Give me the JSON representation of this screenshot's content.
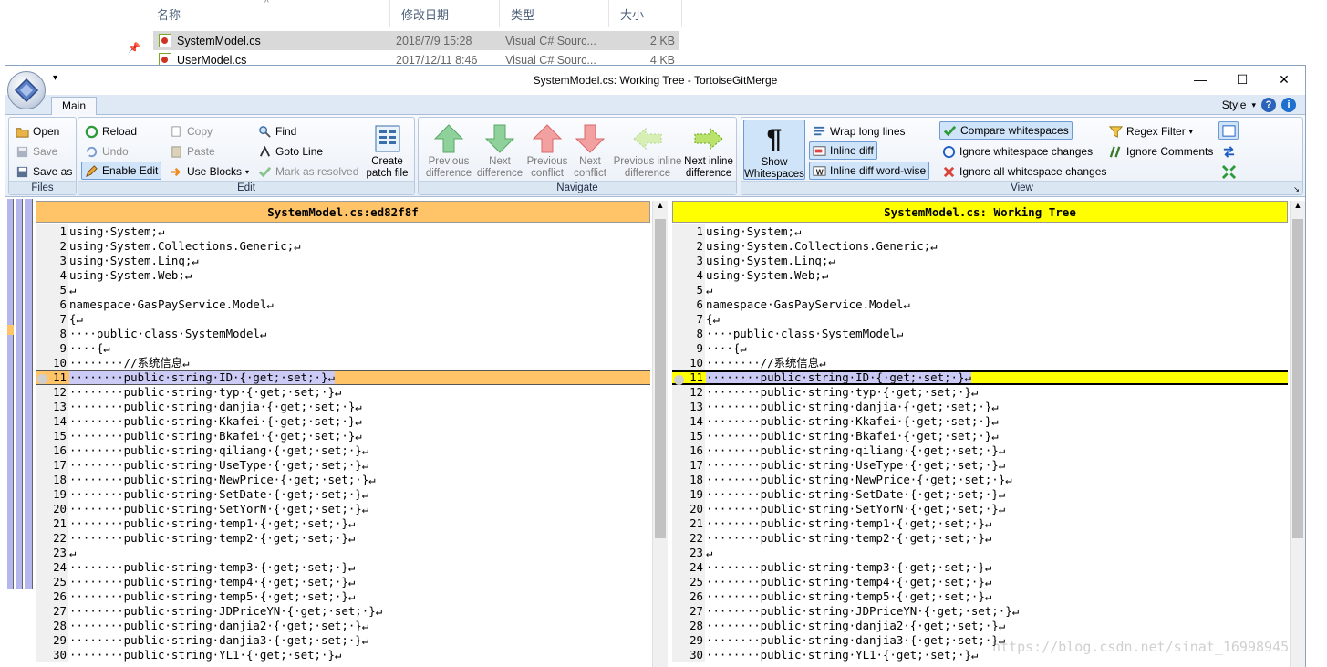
{
  "explorer": {
    "columns": [
      "名称",
      "修改日期",
      "类型",
      "大小"
    ],
    "files": [
      {
        "name": "SystemModel.cs",
        "date": "2018/7/9 15:28",
        "type": "Visual C# Sourc...",
        "size": "2 KB"
      },
      {
        "name": "UserModel.cs",
        "date": "2017/12/11 8:46",
        "type": "Visual C# Sourc...",
        "size": "4 KB"
      }
    ]
  },
  "window": {
    "title": "SystemModel.cs: Working Tree - TortoiseGitMerge",
    "qat": "▾",
    "controls": {
      "minimize": "—",
      "maximize": "☐",
      "close": "✕"
    }
  },
  "ribbon": {
    "tab_main": "Main",
    "style_label": "Style",
    "groups": {
      "files": "Files",
      "edit": "Edit",
      "navigate": "Navigate",
      "view": "View"
    },
    "files": {
      "open": "Open",
      "save": "Save",
      "save_as": "Save as"
    },
    "edit": {
      "reload": "Reload",
      "undo": "Undo",
      "enable_edit": "Enable Edit",
      "copy": "Copy",
      "paste": "Paste",
      "use_blocks": "Use Blocks",
      "find": "Find",
      "goto_line": "Goto Line",
      "mark_resolved": "Mark as resolved",
      "create_patch_1": "Create",
      "create_patch_2": "patch file"
    },
    "navigate": {
      "prev_diff_1": "Previous",
      "prev_diff_2": "difference",
      "next_diff_1": "Next",
      "next_diff_2": "difference",
      "prev_conflict_1": "Previous",
      "prev_conflict_2": "conflict",
      "next_conflict_1": "Next",
      "next_conflict_2": "conflict",
      "prev_inline_1": "Previous inline",
      "prev_inline_2": "difference",
      "next_inline_1": "Next inline",
      "next_inline_2": "difference"
    },
    "view": {
      "show_ws_1": "Show",
      "show_ws_2": "Whitespaces",
      "wrap": "Wrap long lines",
      "inline_diff": "Inline diff",
      "inline_word": "Inline diff word-wise",
      "compare_ws": "Compare whitespaces",
      "ignore_ws_changes": "Ignore whitespace changes",
      "ignore_all_ws": "Ignore all whitespace changes",
      "regex_filter": "Regex Filter",
      "ignore_comments": "Ignore Comments"
    }
  },
  "left_pane": {
    "header": "SystemModel.cs:ed82f8f",
    "header_color": "#ffc468"
  },
  "right_pane": {
    "header": "SystemModel.cs: Working Tree",
    "header_color": "#ffff00"
  },
  "changed_line_colors": {
    "left": "#ffc468",
    "right": "#ffff00"
  },
  "code_lines": [
    {
      "n": "1",
      "t": "using·System;↵"
    },
    {
      "n": "2",
      "t": "using·System.Collections.Generic;↵"
    },
    {
      "n": "3",
      "t": "using·System.Linq;↵"
    },
    {
      "n": "4",
      "t": "using·System.Web;↵"
    },
    {
      "n": "5",
      "t": "↵"
    },
    {
      "n": "6",
      "t": "namespace·GasPayService.Model↵"
    },
    {
      "n": "7",
      "t": "{↵"
    },
    {
      "n": "8",
      "t": "····public·class·SystemModel↵"
    },
    {
      "n": "9",
      "t": "····{↵"
    },
    {
      "n": "10",
      "t": "········//系统信息↵"
    },
    {
      "n": "11",
      "t": "········public·string·ID·{·get;·set;·}↵"
    },
    {
      "n": "12",
      "t": "········public·string·typ·{·get;·set;·}↵"
    },
    {
      "n": "13",
      "t": "········public·string·danjia·{·get;·set;·}↵"
    },
    {
      "n": "14",
      "t": "········public·string·Kkafei·{·get;·set;·}↵"
    },
    {
      "n": "15",
      "t": "········public·string·Bkafei·{·get;·set;·}↵"
    },
    {
      "n": "16",
      "t": "········public·string·qiliang·{·get;·set;·}↵"
    },
    {
      "n": "17",
      "t": "········public·string·UseType·{·get;·set;·}↵"
    },
    {
      "n": "18",
      "t": "········public·string·NewPrice·{·get;·set;·}↵"
    },
    {
      "n": "19",
      "t": "········public·string·SetDate·{·get;·set;·}↵"
    },
    {
      "n": "20",
      "t": "········public·string·SetYorN·{·get;·set;·}↵"
    },
    {
      "n": "21",
      "t": "········public·string·temp1·{·get;·set;·}↵"
    },
    {
      "n": "22",
      "t": "········public·string·temp2·{·get;·set;·}↵"
    },
    {
      "n": "23",
      "t": "↵"
    },
    {
      "n": "24",
      "t": "········public·string·temp3·{·get;·set;·}↵"
    },
    {
      "n": "25",
      "t": "········public·string·temp4·{·get;·set;·}↵"
    },
    {
      "n": "26",
      "t": "········public·string·temp5·{·get;·set;·}↵"
    },
    {
      "n": "27",
      "t": "········public·string·JDPriceYN·{·get;·set;·}↵"
    },
    {
      "n": "28",
      "t": "········public·string·danjia2·{·get;·set;·}↵"
    },
    {
      "n": "29",
      "t": "········public·string·danjia3·{·get;·set;·}↵"
    },
    {
      "n": "30",
      "t": "········public·string·YL1·{·get;·set;·}↵"
    }
  ],
  "watermark": "https://blog.csdn.net/sinat_16998945"
}
